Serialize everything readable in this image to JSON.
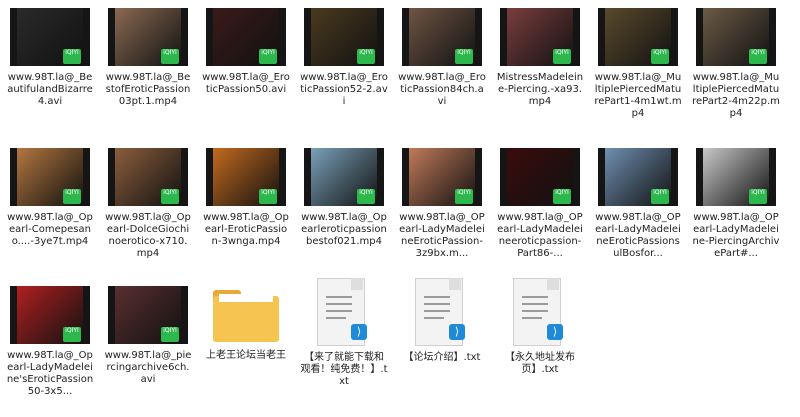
{
  "files": [
    {
      "name": "www.98T.la@_BeautifulandBizarre4.avi",
      "type": "video",
      "color": "#2a2a2a"
    },
    {
      "name": "www.98T.la@_BestofEroticPassion03pt.1.mp4",
      "type": "video",
      "color": "#8a6a52"
    },
    {
      "name": "www.98T.la@_EroticPassion50.avi",
      "type": "video",
      "color": "#3a1a1a"
    },
    {
      "name": "www.98T.la@_EroticPassion52-2.avi",
      "type": "video",
      "color": "#4a3a1f"
    },
    {
      "name": "www.98T.la@_EroticPassion84ch.avi",
      "type": "video",
      "color": "#6f5444"
    },
    {
      "name": "MistressMadeleine-Piercing.-xa93.mp4",
      "type": "video",
      "color": "#7a3d3d"
    },
    {
      "name": "www.98T.la@_MultiplePiercedMaturePart1-4m1wt.mp4",
      "type": "video",
      "color": "#5a4a2c"
    },
    {
      "name": "www.98T.la@_MultiplePiercedMaturePart2-4m22p.mp4",
      "type": "video",
      "color": "#6b5a45"
    },
    {
      "name": "www.98T.la@_Opearl-Comepesano....-3ye7t.mp4",
      "type": "video",
      "color": "#b3773f"
    },
    {
      "name": "www.98T.la@_Opearl-DolceGiochinoerotico-x710.mp4",
      "type": "video",
      "color": "#8b5e3c"
    },
    {
      "name": "www.98T.la@_Opearl-EroticPassion-3wnga.mp4",
      "type": "video",
      "color": "#c46a1f"
    },
    {
      "name": "www.98T.la@_Opearleroticpassionbestof021.mp4",
      "type": "video",
      "color": "#7aa0b8"
    },
    {
      "name": "www.98T.la@_OPearl-LadyMadeleineEroticPassion-3z9bx.m...",
      "type": "video",
      "color": "#c17a59"
    },
    {
      "name": "www.98T.la@_OPearl-LadyMadeleineeroticpassion-Part86-...",
      "type": "video",
      "color": "#3a0c0c"
    },
    {
      "name": "www.98T.la@_OPearl-LadyMadeleineEroticPassionsulBosfor...",
      "type": "video",
      "color": "#6f8fb0"
    },
    {
      "name": "www.98T.la@_OPearl-LadyMadeleine-PiercingArchivePart#...",
      "type": "video",
      "color": "#c8c8c8"
    },
    {
      "name": "www.98T.la@_Opearl-LadyMadeleine'sEroticPassion50-3x5...",
      "type": "video",
      "color": "#b02020"
    },
    {
      "name": "www.98T.la@_piercingarchive6ch.avi",
      "type": "video",
      "color": "#5a2f2f"
    },
    {
      "name": "上老王论坛当老王",
      "type": "folder"
    },
    {
      "name": "【来了就能下载和观看！纯免费！】.txt",
      "type": "text"
    },
    {
      "name": "【论坛介绍】.txt",
      "type": "text"
    },
    {
      "name": "【永久地址发布页】.txt",
      "type": "text"
    }
  ],
  "badge_text": "iQIYI"
}
